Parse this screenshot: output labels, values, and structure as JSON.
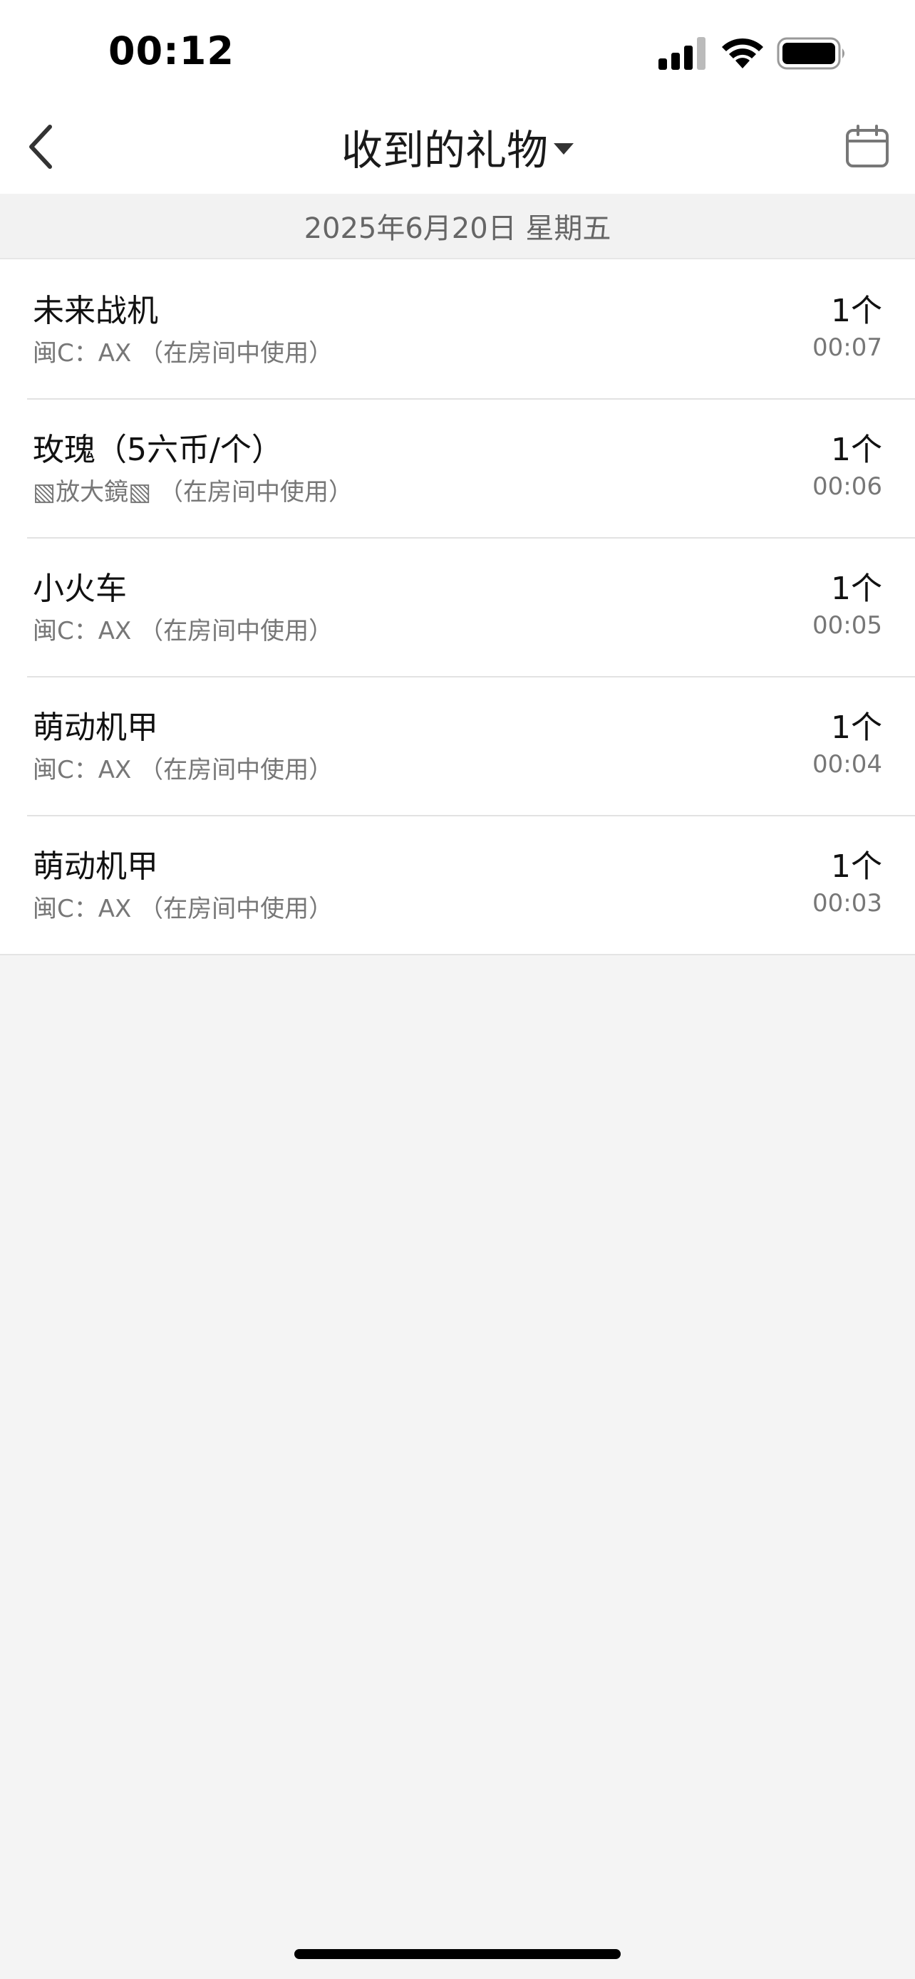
{
  "status_bar": {
    "time": "00:12"
  },
  "nav": {
    "title": "收到的礼物",
    "back_icon": "chevron-left-icon",
    "calendar_icon": "calendar-icon"
  },
  "date_header": "2025年6月20日 星期五",
  "gifts": [
    {
      "name": "未来战机",
      "sub": "闽C：AX （在房间中使用）",
      "count": "1个",
      "time": "00:07"
    },
    {
      "name": "玫瑰（5六币/个）",
      "sub": "▧放大鏡▧ （在房间中使用）",
      "count": "1个",
      "time": "00:06"
    },
    {
      "name": "小火车",
      "sub": "闽C：AX （在房间中使用）",
      "count": "1个",
      "time": "00:05"
    },
    {
      "name": "萌动机甲",
      "sub": "闽C：AX （在房间中使用）",
      "count": "1个",
      "time": "00:04"
    },
    {
      "name": "萌动机甲",
      "sub": "闽C：AX （在房间中使用）",
      "count": "1个",
      "time": "00:03"
    }
  ]
}
